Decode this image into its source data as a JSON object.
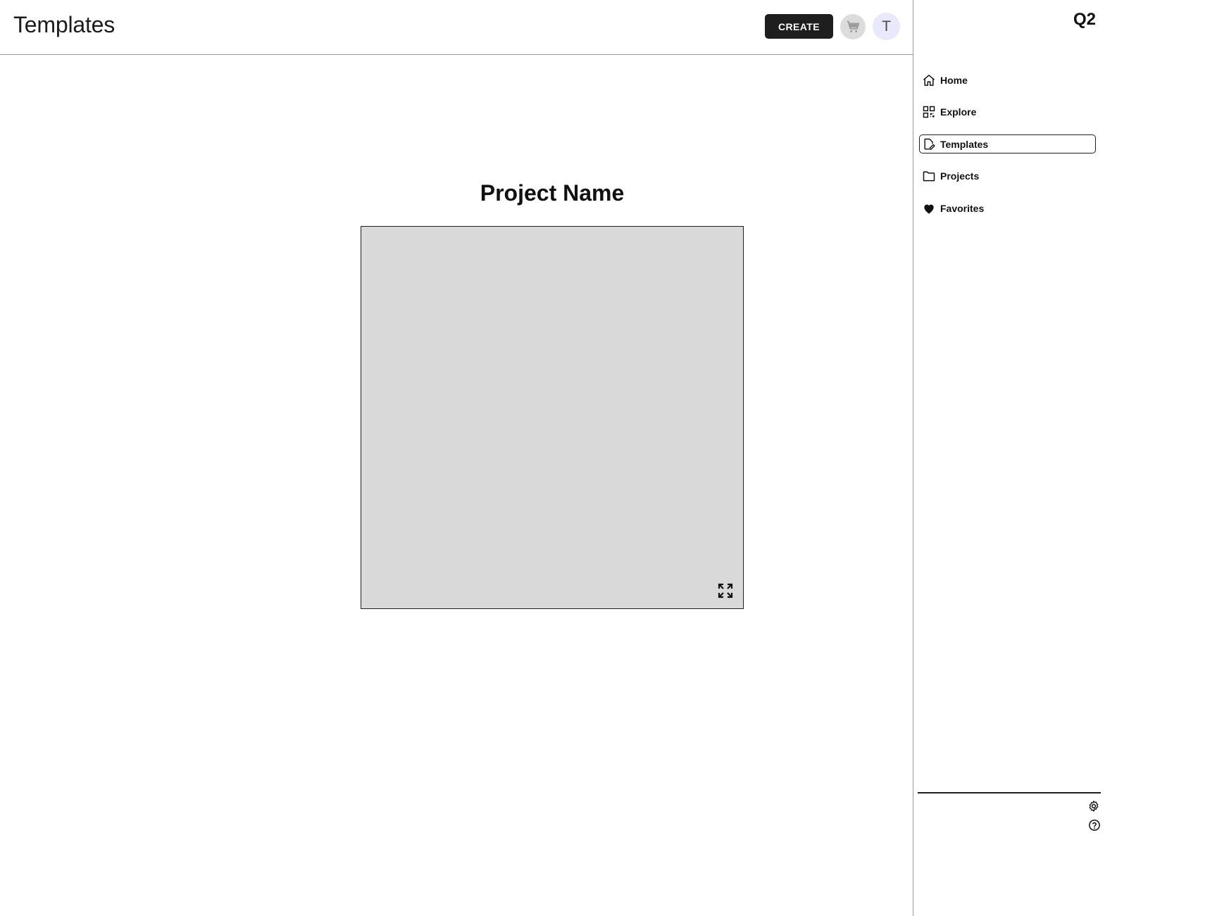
{
  "header": {
    "title": "Templates",
    "create_label": "CREATE",
    "cart_icon": "cart-icon",
    "avatar_initial": "T"
  },
  "sidebar": {
    "logo": "Q2",
    "items": [
      {
        "label": "Home",
        "icon": "home-icon",
        "active": false
      },
      {
        "label": "Explore",
        "icon": "grid-icon",
        "active": false
      },
      {
        "label": "Templates",
        "icon": "edit-file-icon",
        "active": true
      },
      {
        "label": "Projects",
        "icon": "folder-icon",
        "active": false
      },
      {
        "label": "Favorites",
        "icon": "heart-icon",
        "active": false
      }
    ],
    "utility_icons": [
      "gear-icon",
      "help-icon"
    ]
  },
  "main": {
    "project_title": "Project Name",
    "preview_icon": "expand-icon"
  },
  "colors": {
    "primary_button": "#1e1e1e",
    "avatar_bg": "#eae8fb",
    "cart_bg": "#dcdcdc",
    "preview_bg": "#d9d9d9"
  }
}
